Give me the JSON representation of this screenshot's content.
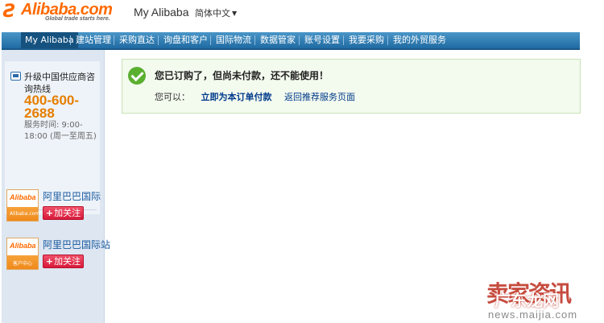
{
  "header": {
    "logo_glyph": "Ƨ",
    "logo_text": "Alibaba.com",
    "logo_tagline": "Global trade starts here.",
    "title": "My Alibaba",
    "language": "简体中文"
  },
  "nav": {
    "items": [
      {
        "label": "My Alibaba"
      },
      {
        "label": "建站管理"
      },
      {
        "label": "采购直达"
      },
      {
        "label": "询盘和客户"
      },
      {
        "label": "国际物流"
      },
      {
        "label": "数据管家"
      },
      {
        "label": "账号设置"
      },
      {
        "label": "我要采购"
      },
      {
        "label": "我的外贸服务"
      }
    ]
  },
  "sidebar": {
    "hotline_title": "升级中国供应商咨询热线",
    "hotline_number": "400-600-2688",
    "hotline_hours": "服务时间: 9:00-18:00 (周一至周五)",
    "services": [
      {
        "name": "阿里巴巴国际",
        "thumb_logo": "Alibaba",
        "thumb_tag": "Alibaba.com",
        "follow": "加关注",
        "plus": "+"
      },
      {
        "name": "阿里巴巴国际站",
        "thumb_logo": "Alibaba",
        "thumb_tag": "客户中心",
        "follow": "加关注",
        "plus": "+"
      }
    ]
  },
  "notice": {
    "message": "您已订购了，但尚未付款，还不能使用！",
    "prefix": "您可以：",
    "pay_link": "立即为本订单付款",
    "back_link": "返回推荐服务页面"
  },
  "watermark": {
    "main": "卖家资讯",
    "overlay": "广东龙网",
    "url": "news.maijia.com"
  },
  "colors": {
    "nav_bg": "#2a78b4",
    "brand": "#ff6a00",
    "success": "#5aaf2f",
    "link": "#003a8c",
    "follow_button": "#d81a3a"
  }
}
